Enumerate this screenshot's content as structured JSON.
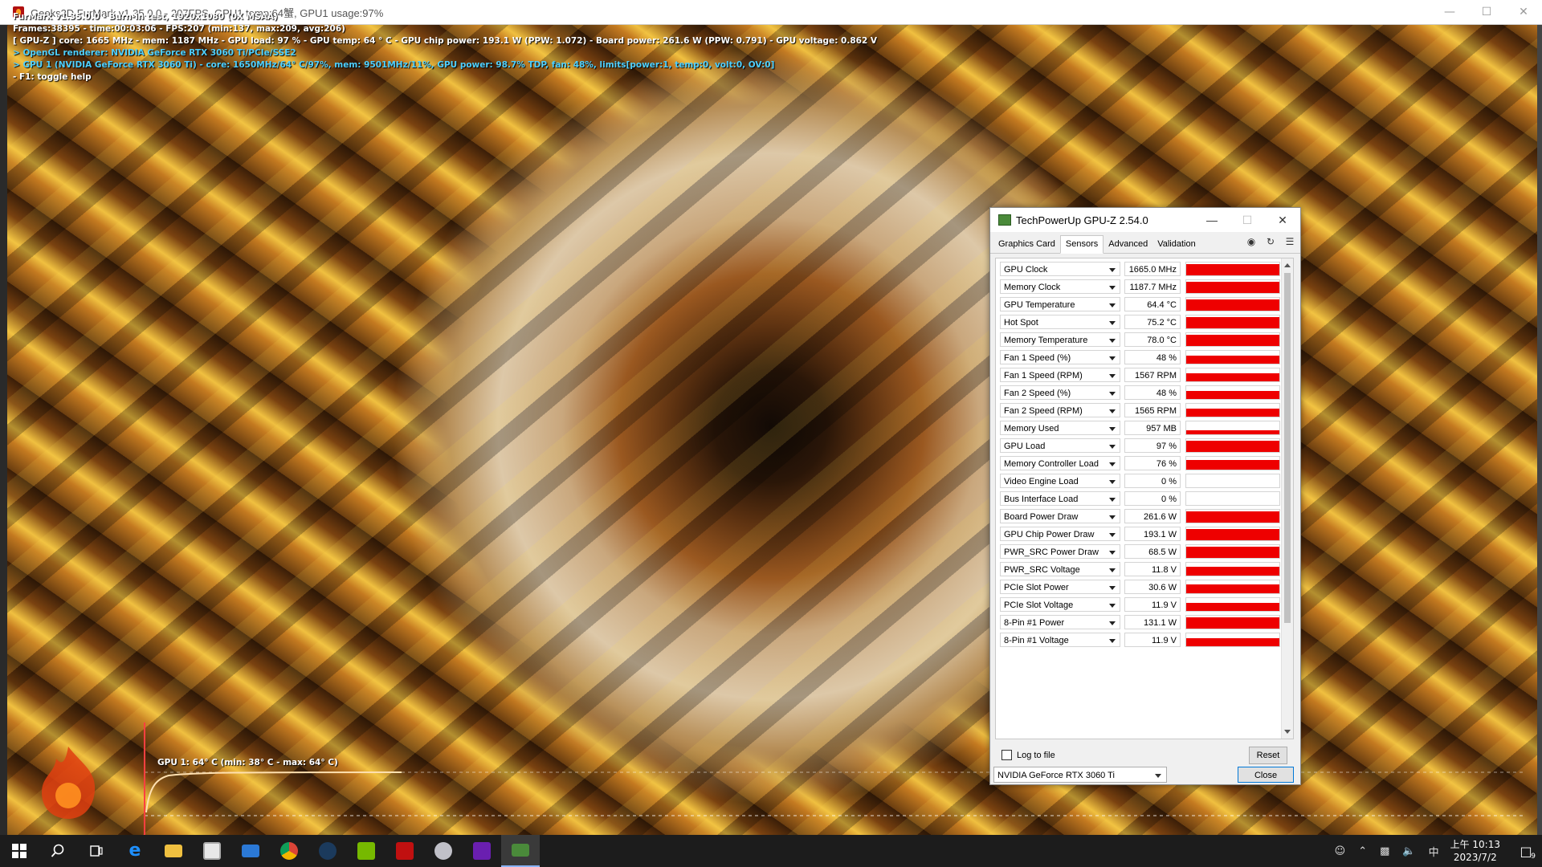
{
  "furmark": {
    "title": "Geeks3D FurMark v1.35.0.0 - 207FPS, GPU1 temp:64蟹, GPU1 usage:97%",
    "overlay": {
      "line1": "FurMark v1.35.0.0 - Burn-in test, 1920x1080 (0X MSAA)",
      "line2": "Frames:38395 - time:00:03:06 - FPS:207 (min:137, max:209, avg:206)",
      "line3": "[ GPU-Z ] core: 1665 MHz - mem: 1187 MHz - GPU load: 97 % - GPU temp: 64 ° C - GPU chip power: 193.1 W (PPW: 1.072) - Board power: 261.6 W (PPW: 0.791) - GPU voltage: 0.862 V",
      "line4": "> OpenGL renderer: NVIDIA GeForce RTX 3060 Ti/PCIe/SSE2",
      "line5": "> GPU 1 (NVIDIA GeForce RTX 3060 Ti) - core: 1650MHz/64° C/97%, mem: 9501MHz/11%, GPU power: 98.7% TDP, fan: 48%, limits[power:1, temp:0, volt:0, OV:0]",
      "line6": "- F1: toggle help"
    },
    "temp_graph_label": "GPU 1: 64° C (min: 38° C - max: 64° C)"
  },
  "gpuz": {
    "title": "TechPowerUp GPU-Z 2.54.0",
    "tabs": [
      "Graphics Card",
      "Sensors",
      "Advanced",
      "Validation"
    ],
    "active_tab": "Sensors",
    "sensors": [
      {
        "name": "GPU Clock",
        "value": "1665.0 MHz",
        "level": 1.0
      },
      {
        "name": "Memory Clock",
        "value": "1187.7 MHz",
        "level": 1.0
      },
      {
        "name": "GPU Temperature",
        "value": "64.4 °C",
        "level": 0.95
      },
      {
        "name": "Hot Spot",
        "value": "75.2 °C",
        "level": 0.95
      },
      {
        "name": "Memory Temperature",
        "value": "78.0 °C",
        "level": 0.95
      },
      {
        "name": "Fan 1 Speed (%)",
        "value": "48 %",
        "level": 0.6
      },
      {
        "name": "Fan 1 Speed (RPM)",
        "value": "1567 RPM",
        "level": 0.6
      },
      {
        "name": "Fan 2 Speed (%)",
        "value": "48 %",
        "level": 0.6
      },
      {
        "name": "Fan 2 Speed (RPM)",
        "value": "1565 RPM",
        "level": 0.6
      },
      {
        "name": "Memory Used",
        "value": "957 MB",
        "level": 0.05
      },
      {
        "name": "GPU Load",
        "value": "97 %",
        "level": 0.97
      },
      {
        "name": "Memory Controller Load",
        "value": "76 %",
        "level": 0.76
      },
      {
        "name": "Video Engine Load",
        "value": "0 %",
        "level": 0
      },
      {
        "name": "Bus Interface Load",
        "value": "0 %",
        "level": 0
      },
      {
        "name": "Board Power Draw",
        "value": "261.6 W",
        "level": 0.97
      },
      {
        "name": "GPU Chip Power Draw",
        "value": "193.1 W",
        "level": 0.97
      },
      {
        "name": "PWR_SRC Power Draw",
        "value": "68.5 W",
        "level": 0.97
      },
      {
        "name": "PWR_SRC Voltage",
        "value": "11.8 V",
        "level": 0.7
      },
      {
        "name": "PCIe Slot Power",
        "value": "30.6 W",
        "level": 0.7
      },
      {
        "name": "PCIe Slot Voltage",
        "value": "11.9 V",
        "level": 0.6
      },
      {
        "name": "8-Pin #1 Power",
        "value": "131.1 W",
        "level": 0.97
      },
      {
        "name": "8-Pin #1 Voltage",
        "value": "11.9 V",
        "level": 0.6
      }
    ],
    "log_label": "Log to file",
    "reset_label": "Reset",
    "gpu_select": "NVIDIA GeForce RTX 3060 Ti",
    "close_label": "Close"
  },
  "taskbar": {
    "apps": [
      "start-icon",
      "search-icon",
      "task-view-icon",
      "edge-icon",
      "file-explorer-icon",
      "store-icon",
      "mail-icon",
      "chrome-icon",
      "steam-icon",
      "nvidia-icon",
      "furmark-icon",
      "gpu-shark-icon",
      "nzxt-cam-icon",
      "gpuz-icon"
    ],
    "ime": "中",
    "time": "上午 10:13",
    "date": "2023/7/2",
    "notifications": "9"
  },
  "colors": {
    "sensor_bar": "#ee0000",
    "overlay_cyan": "#4fd0ff"
  }
}
